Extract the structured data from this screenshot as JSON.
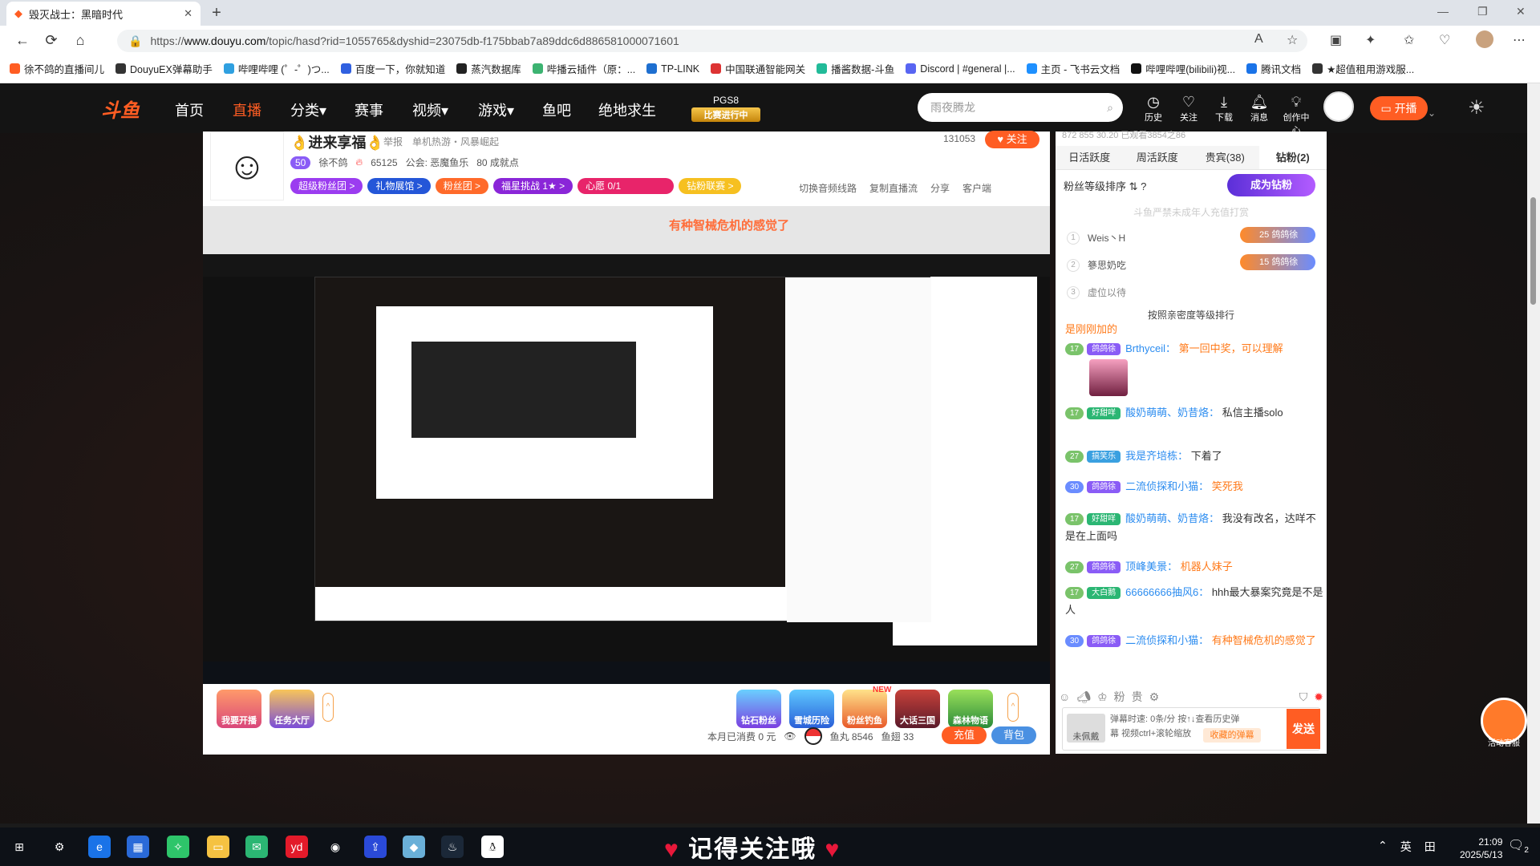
{
  "browser": {
    "tab_title": "毁灭战士：黑暗时代",
    "url_prefix": "https://",
    "url_host": "www.douyu.com",
    "url_path": "/topic/hasd?rid=1055765&dyshid=23075db-f175bbab7a89ddc6d886581000071601",
    "bookmarks": [
      "徐不鸽的直播间儿",
      "DouyuEX弹幕助手",
      "哔哩哔哩 (゜-゜)つ...",
      "百度一下，你就知道",
      "蒸汽数据库",
      "哔播云插件（原：...",
      "TP-LINK",
      "中国联通智能网关",
      "播酱数据-斗鱼",
      "Discord | #general |...",
      "主页 - 飞书云文档",
      "哔哩哔哩(bilibili)视...",
      "腾讯文档",
      "★超值租用游戏服..."
    ]
  },
  "site": {
    "logo": "斗鱼",
    "nav": [
      "首页",
      "直播",
      "分类▾",
      "赛事",
      "视频▾",
      "游戏▾",
      "鱼吧",
      "绝地求生"
    ],
    "event_title": "PGS8",
    "event_status": "比赛进行中",
    "search_placeholder": "雨夜腾龙",
    "header_icons": [
      "历史",
      "关注",
      "下载",
      "消息",
      "创作中心"
    ],
    "live_button": "开播"
  },
  "room": {
    "title": "👌进来享福👌",
    "report": "举报",
    "category": "单机热游・风暴崛起",
    "level": "50",
    "anchor": "徐不鸽",
    "heat": "65125",
    "guild": "公会: 恶魔鱼乐",
    "achievements": "80 成就点",
    "viewers": "131053",
    "follow": "关注",
    "badges": [
      "超级粉丝团 >",
      "礼物展馆 >",
      "粉丝团 >",
      "福星挑战 1★ >",
      "心愿 0/1",
      "钻粉联赛 >"
    ],
    "actions": [
      "切换音频线路",
      "复制直播流",
      "分享",
      "客户端"
    ]
  },
  "video": {
    "overlay_title": "有种智械危机的感觉了"
  },
  "bottom": {
    "left_buttons": [
      "我要开播",
      "任务大厅"
    ],
    "gifts": [
      "钻石粉丝",
      "雪城历险",
      "粉丝钓鱼",
      "大话三国",
      "森林物语"
    ],
    "gift_new": "NEW",
    "consume": "本月已消费 0 元",
    "fishball": "鱼丸 8546",
    "fishfin": "鱼翅 33",
    "recharge": "充值",
    "bag": "背包"
  },
  "rank": {
    "stats": "872  855  30.20  已观看3854之86",
    "tabs": [
      "日活跃度",
      "周活跃度",
      "贵宾(38)",
      "钻粉(2)"
    ],
    "sort_label": "粉丝等级排序 ⇅ ?",
    "become_fan": "成为钻粉",
    "notice": "斗鱼严禁未成年人充值打赏",
    "entries": [
      {
        "n": "1",
        "name": "Weis丶H",
        "badge": "鸽鸽徐",
        "lv": "25"
      },
      {
        "n": "2",
        "name": "篸思奶吃",
        "badge": "鸽鸽徐",
        "lv": "15"
      },
      {
        "n": "3",
        "name": "虚位以待",
        "badge": "",
        "lv": ""
      }
    ],
    "sort_note": "按照亲密度等级排行"
  },
  "chat": {
    "top_partial": "是刚刚加的",
    "messages": [
      {
        "lv": "17",
        "fan": "鸽鸽徐",
        "user": "Brthyceil：",
        "text": "第一回中奖，可以理解",
        "orange": true
      },
      {
        "lv": "17",
        "fan": "好甜咩",
        "user": "酸奶萌萌、奶昔烙：",
        "text": "私信主播solo",
        "orange": false
      },
      {
        "lv": "27",
        "fan": "搞笑乐",
        "user": "我是齐培栋：",
        "text": "下着了",
        "orange": false
      },
      {
        "lv": "30",
        "fan": "鸽鸽徐",
        "user": "二流侦探和小猫：",
        "text": "笑死我",
        "orange": true
      },
      {
        "lv": "17",
        "fan": "好甜咩",
        "user": "酸奶萌萌、奶昔烙：",
        "text": "我没有改名，达咩不是在上面吗",
        "orange": false
      },
      {
        "lv": "27",
        "fan": "鸽鸽徐",
        "user": "顶峰美景：",
        "text": "机器人妹子",
        "orange": true
      },
      {
        "lv": "17",
        "fan": "大白鹅",
        "user": "66666666抽风6：",
        "text": "hhh最大暴案究竟是不是人",
        "orange": false
      },
      {
        "lv": "30",
        "fan": "鸽鸽徐",
        "user": "二流侦探和小猫：",
        "text": "有种智械危机的感觉了",
        "orange": true
      }
    ],
    "unfan": "未佩戴",
    "info_line1": "弹幕时速: 0条/分 按↑↓查看历史弹",
    "info_line2": "幕 视频ctrl+滚轮缩放",
    "collect": "收藏的弹幕",
    "send": "发送",
    "service": "活动客服"
  },
  "taskbar": {
    "banner": "记得关注哦",
    "tray_lang": "英",
    "time": "21:09",
    "date": "2025/5/13",
    "notif": "2"
  }
}
